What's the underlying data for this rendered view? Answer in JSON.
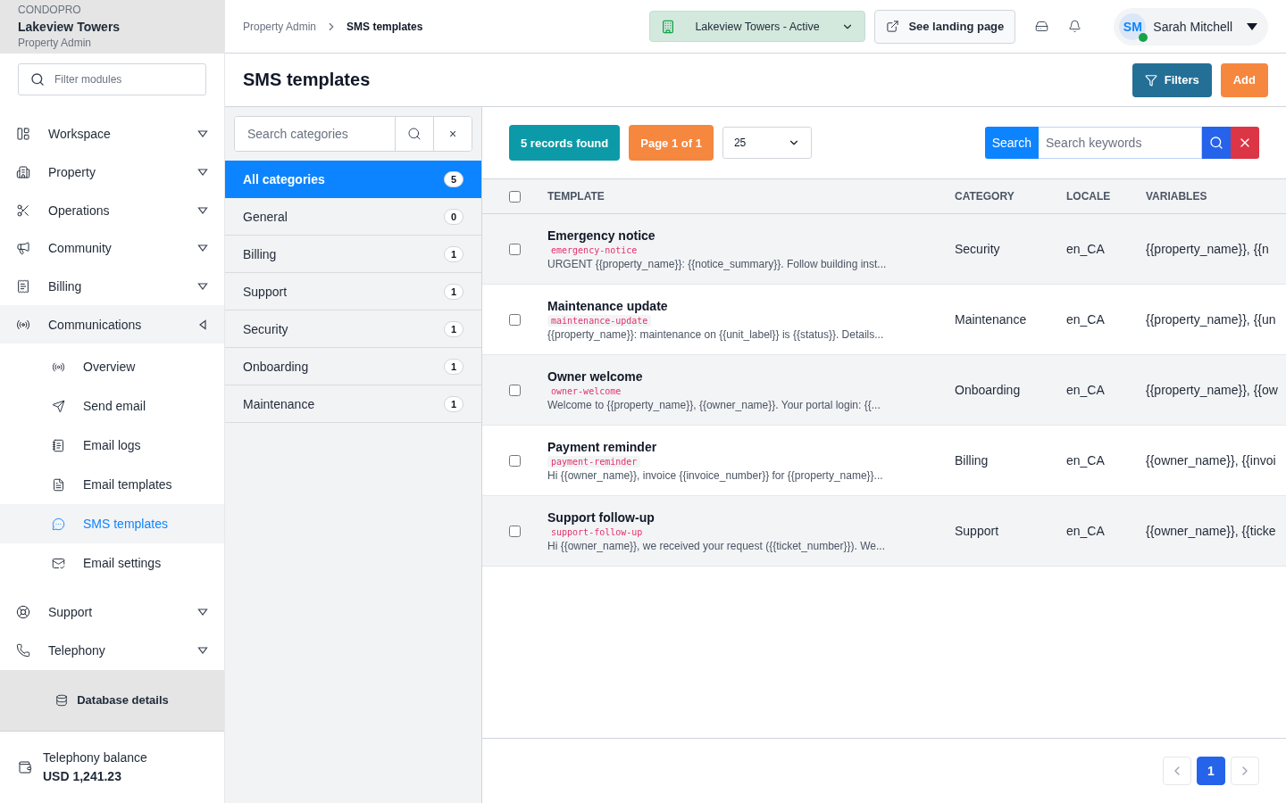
{
  "brand": {
    "product": "CONDOPRO",
    "property": "Lakeview Towers",
    "role": "Property Admin"
  },
  "sidebar": {
    "filter": {
      "placeholder": "Filter modules"
    },
    "items": [
      {
        "label": "Workspace",
        "expanded": false,
        "selected": false
      },
      {
        "label": "Property",
        "expanded": false,
        "selected": false
      },
      {
        "label": "Operations",
        "expanded": false,
        "selected": false
      },
      {
        "label": "Community",
        "expanded": false,
        "selected": false
      },
      {
        "label": "Billing",
        "expanded": false,
        "selected": false
      },
      {
        "label": "Communications",
        "expanded": true,
        "selected": true,
        "children": [
          {
            "label": "Overview",
            "selected": false
          },
          {
            "label": "Send email",
            "selected": false
          },
          {
            "label": "Email logs",
            "selected": false
          },
          {
            "label": "Email templates",
            "selected": false
          },
          {
            "label": "SMS templates",
            "selected": true
          },
          {
            "label": "Email settings",
            "selected": false
          }
        ]
      },
      {
        "label": "Support",
        "expanded": false,
        "selected": false
      },
      {
        "label": "Telephony",
        "expanded": false,
        "selected": false
      }
    ],
    "database_link": "Database details",
    "balance": {
      "label": "Telephony balance",
      "amount": "USD 1,241.23"
    }
  },
  "breadcrumb": [
    "Property Admin",
    "SMS templates"
  ],
  "topbar": {
    "property_select": "Lakeview Towers - Active",
    "landing_button": "See landing page",
    "user": {
      "initials": "SM",
      "name": "Sarah Mitchell",
      "online": true
    }
  },
  "page": {
    "title": "SMS templates",
    "buttons": [
      "Filters",
      "Add"
    ]
  },
  "categories": {
    "search": {
      "placeholder": "Search categories"
    },
    "clear": "×",
    "items": [
      {
        "label": "All categories",
        "count": "5",
        "selected": true
      },
      {
        "label": "General",
        "count": "0",
        "selected": false
      },
      {
        "label": "Billing",
        "count": "1",
        "selected": false
      },
      {
        "label": "Support",
        "count": "1",
        "selected": false
      },
      {
        "label": "Security",
        "count": "1",
        "selected": false
      },
      {
        "label": "Onboarding",
        "count": "1",
        "selected": false
      },
      {
        "label": "Maintenance",
        "count": "1",
        "selected": false
      }
    ]
  },
  "toolbar": {
    "records": "5 records found",
    "page": "Page 1 of 1",
    "page_size": "25",
    "search_label": "Search",
    "search": {
      "placeholder": "Search keywords"
    }
  },
  "table": {
    "all_checked": false,
    "columns": [
      "TEMPLATE",
      "CATEGORY",
      "LOCALE",
      "VARIABLES"
    ],
    "rows": [
      {
        "name": "Emergency notice",
        "slug": "emergency-notice",
        "preview": "URGENT {{property_name}}: {{notice_summary}}. Follow building inst...",
        "category": "Security",
        "locale": "en_CA",
        "variables": "{{property_name}}, {{n",
        "checked": false
      },
      {
        "name": "Maintenance update",
        "slug": "maintenance-update",
        "preview": "{{property_name}}: maintenance on {{unit_label}} is {{status}}. Details...",
        "category": "Maintenance",
        "locale": "en_CA",
        "variables": "{{property_name}}, {{un",
        "checked": false
      },
      {
        "name": "Owner welcome",
        "slug": "owner-welcome",
        "preview": "Welcome to {{property_name}}, {{owner_name}}. Your portal login: {{...",
        "category": "Onboarding",
        "locale": "en_CA",
        "variables": "{{property_name}}, {{ow",
        "checked": false
      },
      {
        "name": "Payment reminder",
        "slug": "payment-reminder",
        "preview": "Hi {{owner_name}}, invoice {{invoice_number}} for {{property_name}}...",
        "category": "Billing",
        "locale": "en_CA",
        "variables": "{{owner_name}}, {{invoi",
        "checked": false
      },
      {
        "name": "Support follow-up",
        "slug": "support-follow-up",
        "preview": "Hi {{owner_name}}, we received your request ({{ticket_number}}). We...",
        "category": "Support",
        "locale": "en_CA",
        "variables": "{{owner_name}}, {{ticke",
        "checked": false
      }
    ]
  },
  "pagination": {
    "pages": [
      {
        "label": "1",
        "selected": true
      }
    ]
  }
}
